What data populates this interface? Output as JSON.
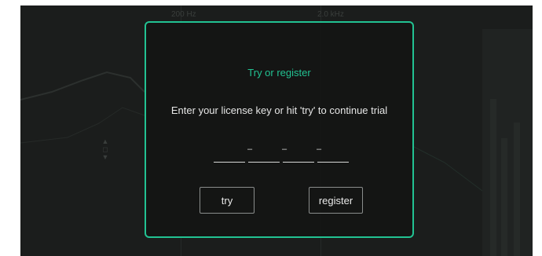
{
  "background": {
    "freq_labels": [
      "200 Hz",
      "2.0 kHz"
    ]
  },
  "dialog": {
    "title": "Try or register",
    "message": "Enter your license key or hit 'try' to continue trial",
    "key_fields": [
      "",
      "",
      "",
      ""
    ],
    "key_separator": "–",
    "try_label": "try",
    "register_label": "register"
  },
  "colors": {
    "accent": "#22c292",
    "background": "#1b1d1c",
    "text": "#e6e6e6"
  }
}
